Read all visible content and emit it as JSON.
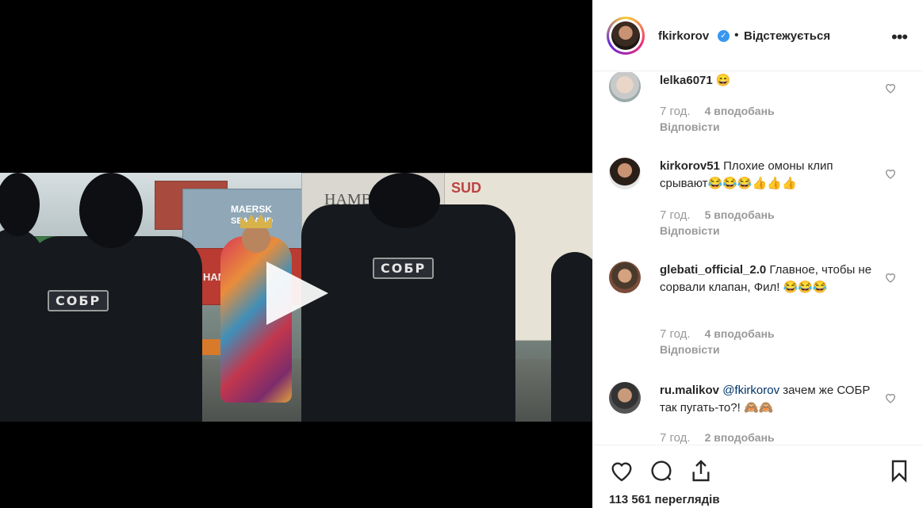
{
  "post": {
    "username": "fkirkorov",
    "verified_badge": "verified-icon",
    "separator": "•",
    "follow_status": "Відстежується",
    "more_icon": "more-options-icon"
  },
  "video": {
    "patch_text": "СОБР",
    "container_text_1": "MAERSK",
    "container_text_2": "SEALAND",
    "container_text_3": "HAMBURG",
    "container_text_4": "HAMBU",
    "container_text_5": "SUD"
  },
  "comments": [
    {
      "username": "lelka6071",
      "text": "😄",
      "time": "7 год.",
      "likes": "4 вподобань",
      "reply": "Відповісти"
    },
    {
      "username": "kirkorov51",
      "text": "Плохие омоны клип срывают😂😂😂👍👍👍",
      "time": "7 год.",
      "likes": "5 вподобань",
      "reply": "Відповісти"
    },
    {
      "username": "glebati_official_2.0",
      "text": "Главное, чтобы не сорвали клапан, Фил! 😂😂😂",
      "time": "7 год.",
      "likes": "4 вподобань",
      "reply": "Відповісти"
    },
    {
      "username": "ru.malikov",
      "mention": "@fkirkorov",
      "text": "зачем же СОБР так пугать-то?! 🙈🙈",
      "time": "7 год.",
      "likes": "2 вподобань"
    }
  ],
  "actions": {
    "views": "113 561 переглядів"
  }
}
